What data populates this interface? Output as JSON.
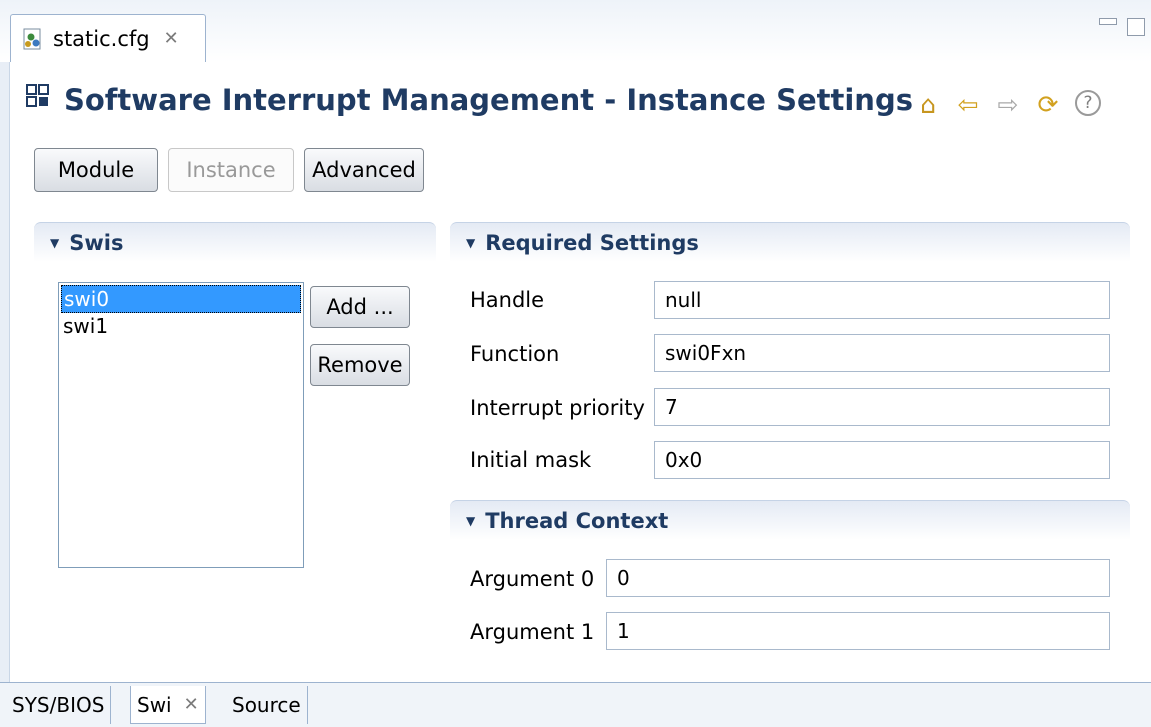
{
  "editor_tab": {
    "label": "static.cfg",
    "icon": "config-file-icon"
  },
  "header": {
    "title": "Software Interrupt Management - Instance Settings",
    "icon": "module-icon"
  },
  "nav_icons": [
    "home-icon",
    "back-icon",
    "forward-icon",
    "sync-icon",
    "help-icon"
  ],
  "buttons": {
    "module": "Module",
    "instance": "Instance",
    "advanced": "Advanced"
  },
  "swis": {
    "title": "Swis",
    "items": [
      "swi0",
      "swi1"
    ],
    "selected": "swi0",
    "add_label": "Add ...",
    "remove_label": "Remove"
  },
  "required_settings": {
    "title": "Required Settings",
    "fields": [
      {
        "label": "Handle",
        "value": "null"
      },
      {
        "label": "Function",
        "value": "swi0Fxn"
      },
      {
        "label": "Interrupt priority",
        "value": "7"
      },
      {
        "label": "Initial mask",
        "value": "0x0"
      }
    ]
  },
  "thread_context": {
    "title": "Thread Context",
    "fields": [
      {
        "label": "Argument 0",
        "value": "0"
      },
      {
        "label": "Argument 1",
        "value": "1"
      }
    ]
  },
  "bottom_tabs": [
    "SYS/BIOS",
    "Swi",
    "Source"
  ],
  "active_bottom_tab": "Swi",
  "colors": {
    "title": "#1f3b63",
    "selection": "#3399ff",
    "accent_gold": "#d2a11f"
  }
}
